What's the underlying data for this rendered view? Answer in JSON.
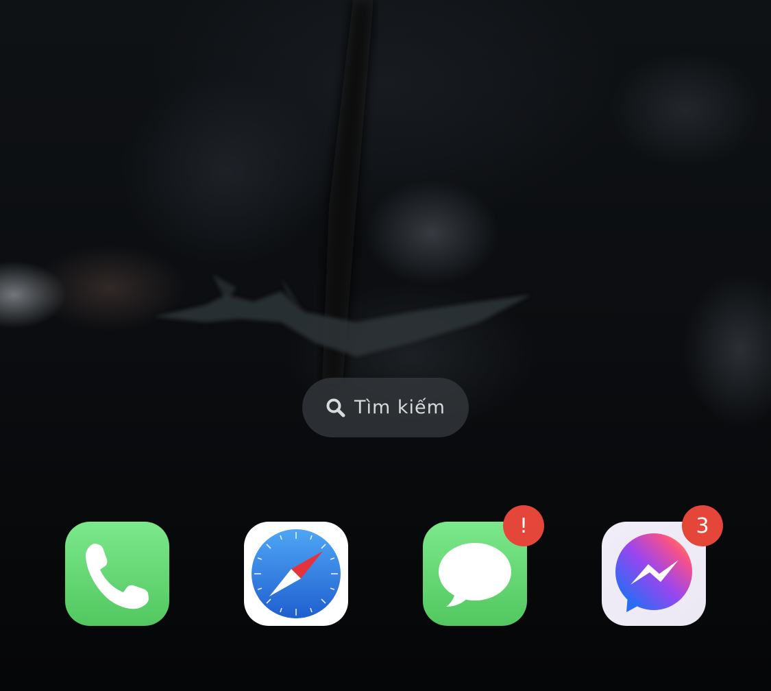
{
  "search": {
    "label": "Tìm kiếm",
    "icon": "search-icon"
  },
  "dock": {
    "apps": [
      {
        "id": "phone",
        "icon": "phone-icon",
        "badge": ""
      },
      {
        "id": "safari",
        "icon": "compass-icon",
        "badge": ""
      },
      {
        "id": "messages",
        "icon": "speech-bubble-icon",
        "badge": "!"
      },
      {
        "id": "messenger",
        "icon": "messenger-bolt-icon",
        "badge": "3"
      }
    ]
  },
  "colors": {
    "badge": "#e4463a",
    "phone_green": "#5fd46a",
    "safari_blue": "#2f79dd",
    "messenger_gradient": [
      "#2f6ff5",
      "#a24bf0",
      "#ff5e7a"
    ]
  }
}
